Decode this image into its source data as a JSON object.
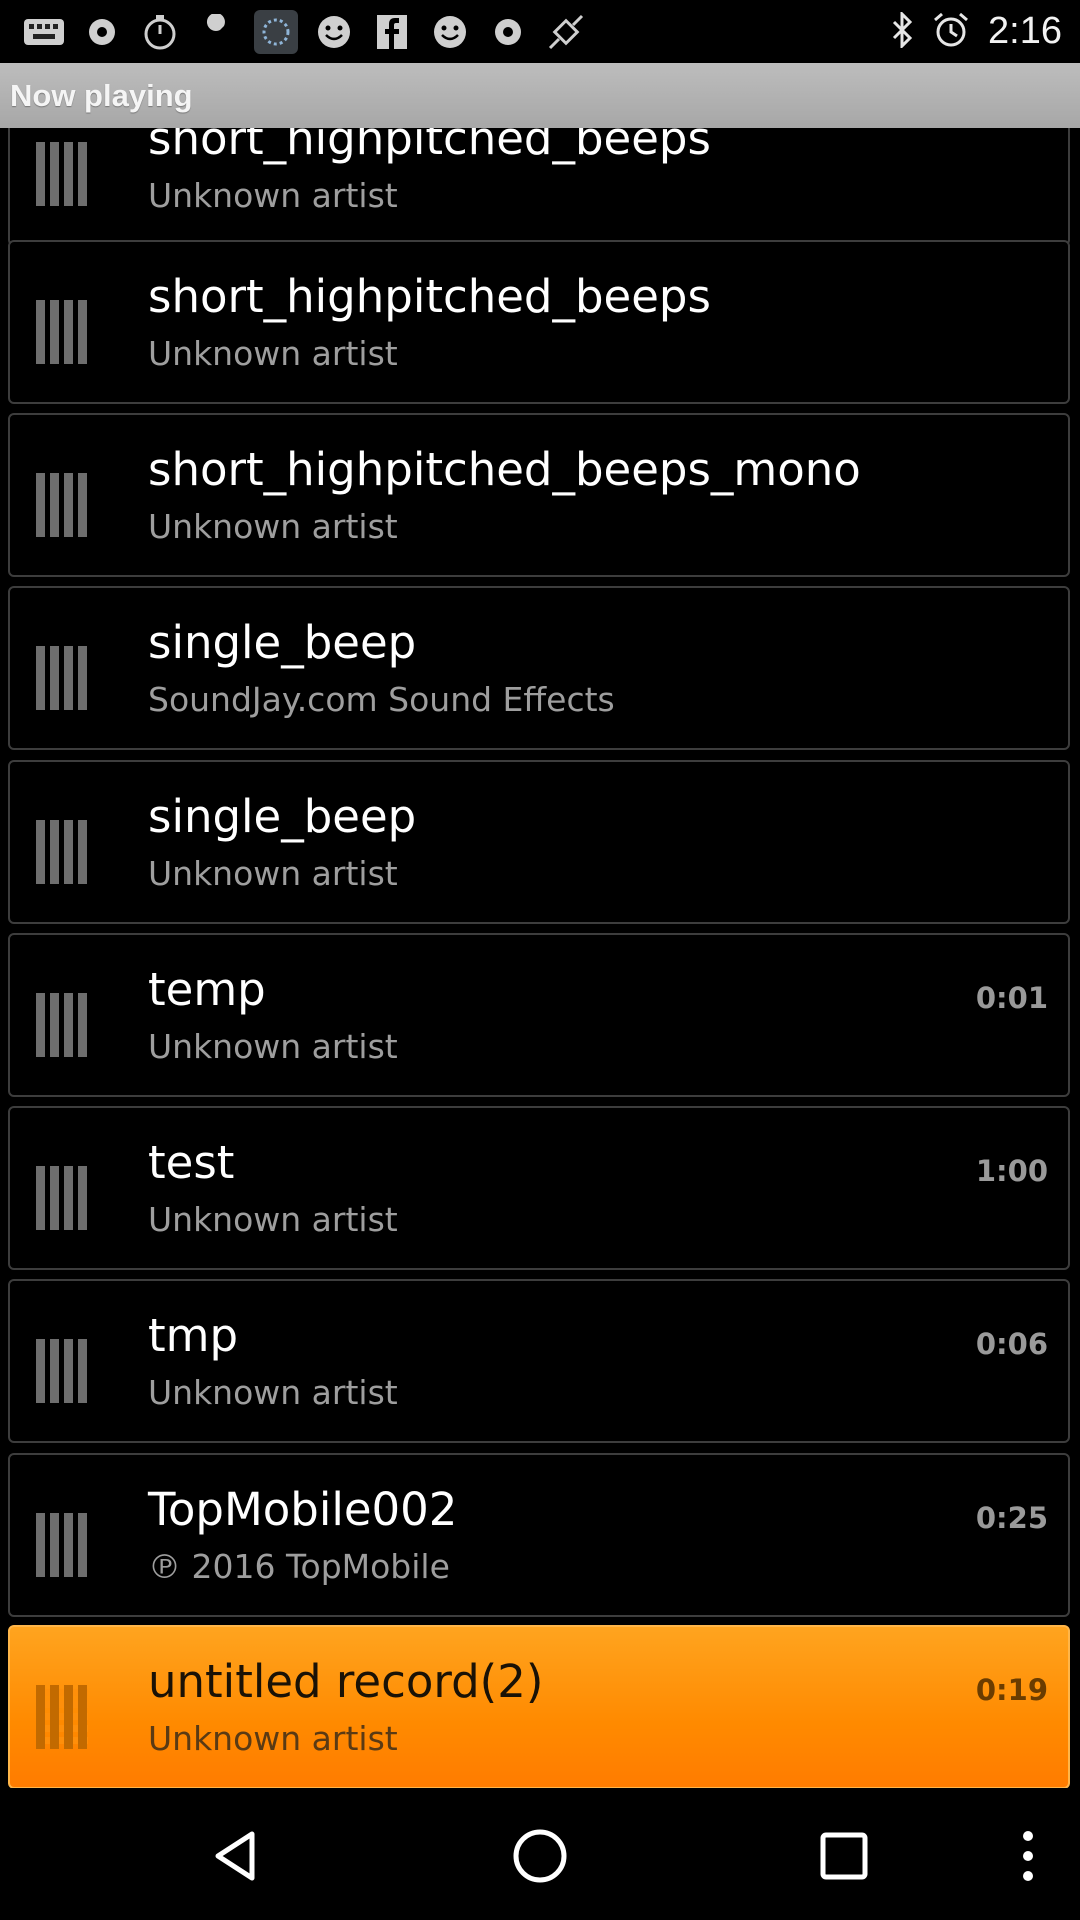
{
  "status_bar": {
    "time": "2:16",
    "left_icons": [
      "keyboard-icon",
      "record-icon",
      "timer-icon",
      "wrench-icon",
      "app-icon",
      "smiley-icon",
      "facebook-icon",
      "smiley-icon",
      "record-icon",
      "fake-gps-icon"
    ],
    "right_icons": [
      "bluetooth-icon",
      "alarm-icon"
    ]
  },
  "title_bar": {
    "title": "Now playing"
  },
  "tracks": [
    {
      "title": "short_highpitched_beeps",
      "artist": "Unknown artist",
      "duration": ""
    },
    {
      "title": "short_highpitched_beeps",
      "artist": "Unknown artist",
      "duration": ""
    },
    {
      "title": "short_highpitched_beeps_mono",
      "artist": "Unknown artist",
      "duration": ""
    },
    {
      "title": "single_beep",
      "artist": "SoundJay.com Sound Effects",
      "duration": ""
    },
    {
      "title": "single_beep",
      "artist": "Unknown artist",
      "duration": ""
    },
    {
      "title": "temp",
      "artist": "Unknown artist",
      "duration": "0:01"
    },
    {
      "title": "test",
      "artist": "Unknown artist",
      "duration": "1:00"
    },
    {
      "title": "tmp",
      "artist": "Unknown artist",
      "duration": "0:06"
    },
    {
      "title": "TopMobile002",
      "artist": "℗ 2016 TopMobile",
      "duration": "0:25"
    },
    {
      "title": "untitled record(2)",
      "artist": "Unknown artist",
      "duration": "0:19",
      "active": true
    }
  ],
  "colors": {
    "accent": "#ff8c00",
    "title_bar": "#b3b3b3"
  },
  "nav_bar": [
    "back-icon",
    "home-icon",
    "recents-icon",
    "more-icon"
  ]
}
